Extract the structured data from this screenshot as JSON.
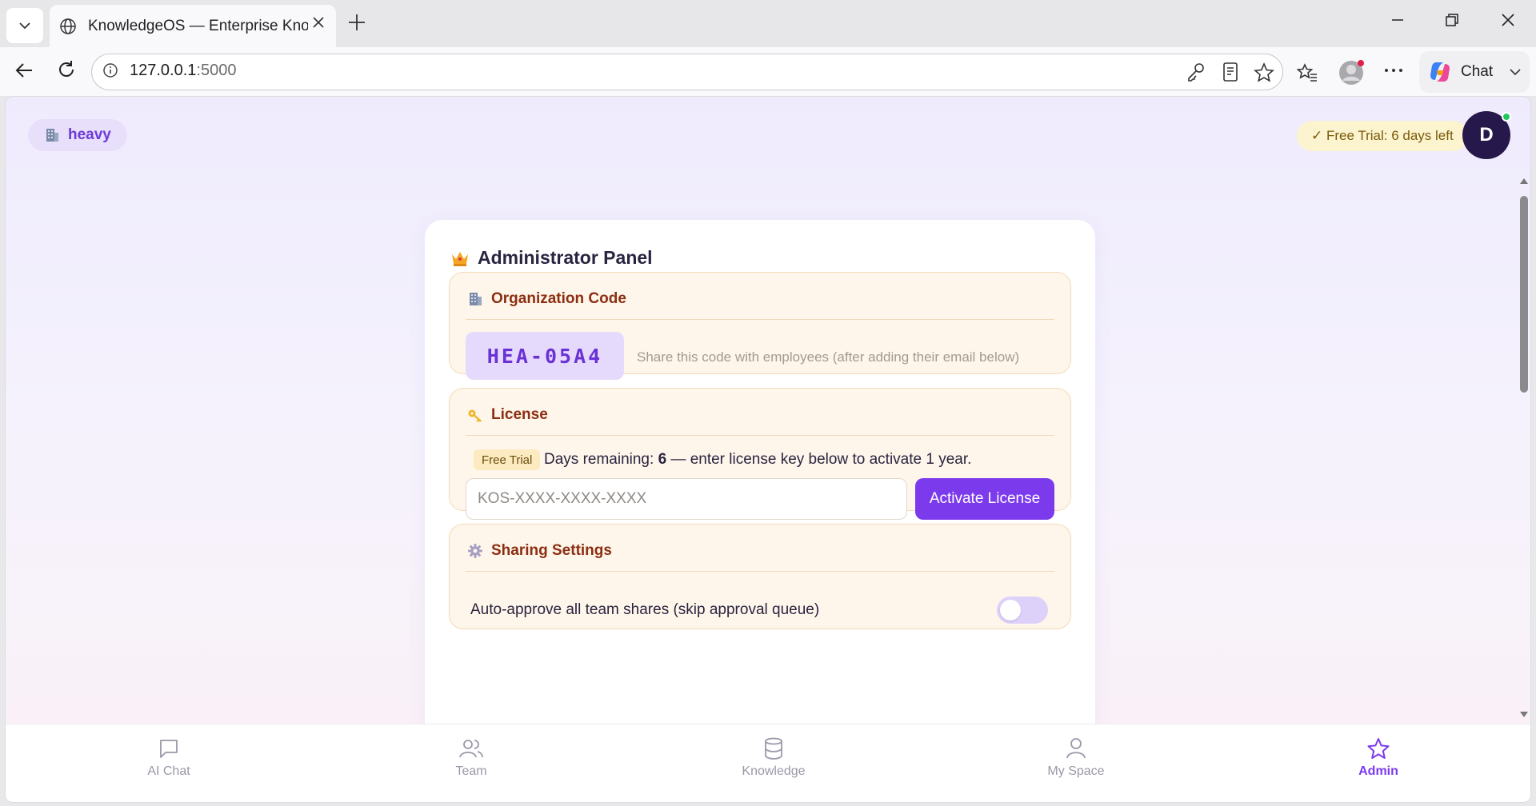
{
  "browser": {
    "tab_title": "KnowledgeOS — Enterprise Knowl",
    "url_host": "127.0.0.1",
    "url_port": ":5000",
    "chat_label": "Chat"
  },
  "header": {
    "org_name": "heavy",
    "trial_badge": "✓ Free Trial: 6 days left",
    "avatar_initial": "D"
  },
  "panel": {
    "title": "Administrator Panel",
    "org_code": {
      "heading": "Organization Code",
      "code": "HEA-05A4",
      "hint": "Share this code with employees (after adding their email below)"
    },
    "license": {
      "heading": "License",
      "tag": "Free Trial",
      "text_prefix": "Days remaining: ",
      "days": "6",
      "text_suffix": " — enter license key below to activate 1 year.",
      "input_value": "",
      "input_placeholder": "KOS-XXXX-XXXX-XXXX",
      "button_label": "Activate License"
    },
    "sharing": {
      "heading": "Sharing Settings",
      "auto_approve_label": "Auto-approve all team shares (skip approval queue)",
      "auto_approve_enabled": false
    }
  },
  "bottom_nav": [
    {
      "label": "AI Chat",
      "icon": "chat-bubble-icon",
      "active": false
    },
    {
      "label": "Team",
      "icon": "users-icon",
      "active": false
    },
    {
      "label": "Knowledge",
      "icon": "database-icon",
      "active": false
    },
    {
      "label": "My Space",
      "icon": "user-icon",
      "active": false
    },
    {
      "label": "Admin",
      "icon": "star-icon",
      "active": true
    }
  ],
  "colors": {
    "accent": "#7c3aed",
    "section_bg": "#fef6ea",
    "section_heading": "#8c2e12",
    "trial_badge_bg": "#fcf3cf",
    "avatar_bg": "#26184a",
    "online_dot": "#22c55e"
  }
}
